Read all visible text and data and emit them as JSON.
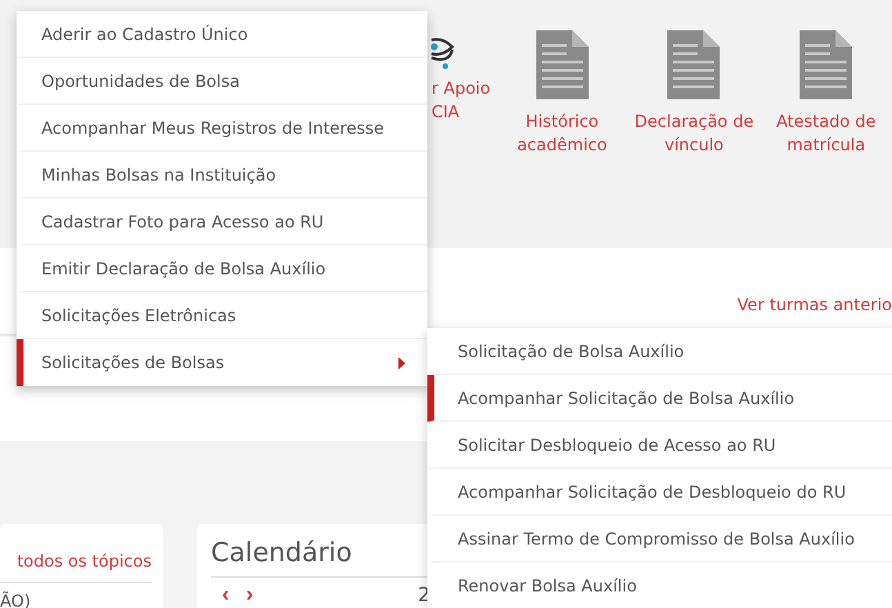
{
  "shortcuts": [
    {
      "kind": "eye",
      "lines": [
        "r Apoio",
        "CIA"
      ]
    },
    {
      "kind": "document",
      "lines": [
        "Histórico",
        "acadêmico"
      ]
    },
    {
      "kind": "document",
      "lines": [
        "Declaração de",
        "vínculo"
      ]
    },
    {
      "kind": "document",
      "lines": [
        "Atestado de",
        "matrícula"
      ]
    }
  ],
  "classes_link": "Ver turmas anterio",
  "forum_card": {
    "link": "todos os tópicos",
    "text": "ÃO)"
  },
  "calendar_card": {
    "title": "Calendário",
    "prev": "‹",
    "next": "›",
    "day": "2"
  },
  "menu": {
    "items": [
      {
        "label": "Aderir ao Cadastro Único",
        "selected": false,
        "has_submenu": false
      },
      {
        "label": "Oportunidades de Bolsa",
        "selected": false,
        "has_submenu": false
      },
      {
        "label": "Acompanhar Meus Registros de Interesse",
        "selected": false,
        "has_submenu": false
      },
      {
        "label": "Minhas Bolsas na Instituição",
        "selected": false,
        "has_submenu": false
      },
      {
        "label": "Cadastrar Foto para Acesso ao RU",
        "selected": false,
        "has_submenu": false
      },
      {
        "label": "Emitir Declaração de Bolsa Auxílio",
        "selected": false,
        "has_submenu": false
      },
      {
        "label": "Solicitações Eletrônicas",
        "selected": false,
        "has_submenu": false
      },
      {
        "label": "Solicitações de Bolsas",
        "selected": true,
        "has_submenu": true
      }
    ]
  },
  "submenu": {
    "items": [
      {
        "label": "Solicitação de Bolsa Auxílio",
        "selected": false
      },
      {
        "label": "Acompanhar Solicitação de Bolsa Auxílio",
        "selected": true
      },
      {
        "label": "Solicitar Desbloqueio de Acesso ao RU",
        "selected": false
      },
      {
        "label": "Acompanhar Solicitação de Desbloqueio do RU",
        "selected": false
      },
      {
        "label": "Assinar Termo de Compromisso de Bolsa Auxílio",
        "selected": false
      },
      {
        "label": "Renovar Bolsa Auxílio",
        "selected": false
      }
    ]
  }
}
